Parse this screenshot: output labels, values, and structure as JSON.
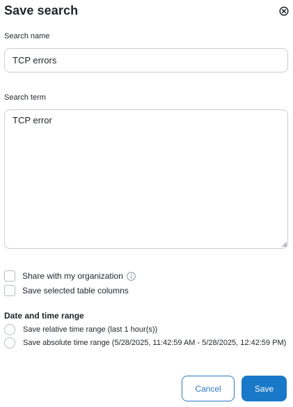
{
  "dialog": {
    "title": "Save search"
  },
  "search_name": {
    "label": "Search name",
    "value": "TCP errors"
  },
  "search_term": {
    "label": "Search term",
    "value": "TCP error"
  },
  "options": {
    "share_label": "Share with my organization",
    "columns_label": "Save selected table columns",
    "share_checked": false,
    "columns_checked": false
  },
  "date_range": {
    "heading": "Date and time range",
    "relative_label": "Save relative time range (last 1 hour(s))",
    "absolute_label": "Save absolute time range (5/28/2025, 11:42:59 AM - 5/28/2025, 12:42:59 PM)"
  },
  "actions": {
    "cancel_label": "Cancel",
    "save_label": "Save"
  },
  "colors": {
    "primary": "#1a78c9",
    "border": "#c9cdd3",
    "text": "#1f2329"
  },
  "icons": {
    "close": "close-circle-icon",
    "info": "info-icon"
  }
}
